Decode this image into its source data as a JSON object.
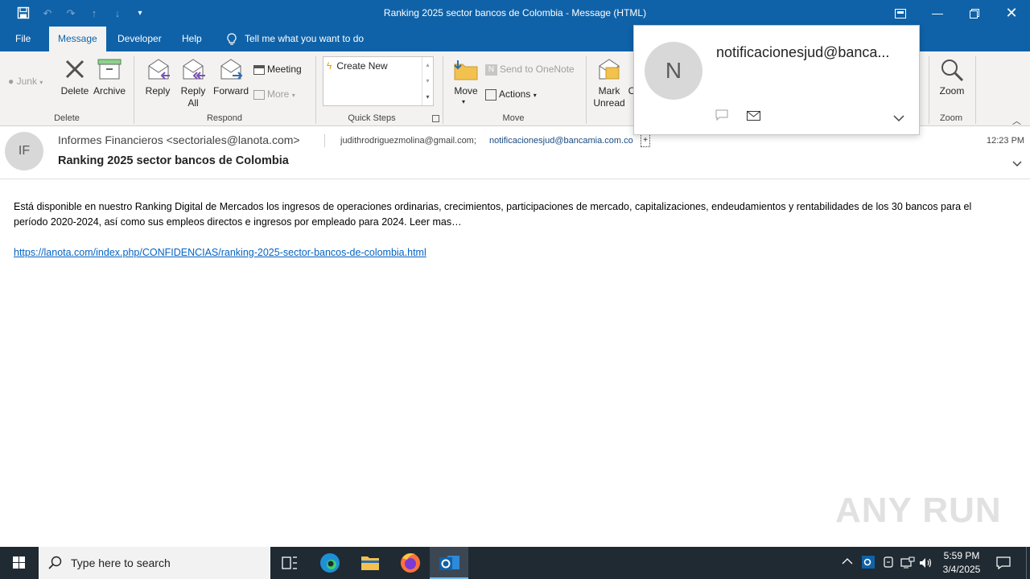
{
  "window": {
    "title": "Ranking 2025 sector bancos de Colombia  -  Message (HTML)"
  },
  "tabs": [
    {
      "label": "File"
    },
    {
      "label": "Message"
    },
    {
      "label": "Developer"
    },
    {
      "label": "Help"
    }
  ],
  "tell_me": "Tell me what you want to do",
  "ribbon": {
    "junk": "Junk",
    "delete": "Delete",
    "archive": "Archive",
    "group_delete": "Delete",
    "reply": "Reply",
    "reply_all_1": "Reply",
    "reply_all_2": "All",
    "forward": "Forward",
    "meeting": "Meeting",
    "more": "More",
    "group_respond": "Respond",
    "create_new": "Create New",
    "group_quick_steps": "Quick Steps",
    "move": "Move",
    "send_onenote": "Send to OneNote",
    "actions": "Actions",
    "group_move": "Move",
    "mark_unread_1": "Mark",
    "mark_unread_2": "Unread",
    "partial_c": "C",
    "zoom": "Zoom",
    "group_zoom": "Zoom"
  },
  "message": {
    "sender_initials": "IF",
    "from": "Informes Financieros <sectoriales@lanota.com>",
    "to_1": "judithrodriguezmolina@gmail.com;",
    "to_2": "notificacionesjud@bancamia.com.co",
    "to_more": "+",
    "time": "12:23 PM",
    "subject": "Ranking 2025 sector bancos de Colombia",
    "body_line": "Está disponible en nuestro Ranking Digital  de Mercados los ingresos de operaciones ordinarias, crecimientos, participaciones de mercado, capitalizaciones, endeudamientos y rentabilidades de los 30 bancos para el período 2020-2024,  así como sus empleos directos e ingresos por empleado para 2024.  Leer mas…",
    "link": "https://lanota.com/index.php/CONFIDENCIAS/ranking-2025-sector-bancos-de-colombia.html"
  },
  "contact_card": {
    "initial": "N",
    "name": "notificacionesjud@banca..."
  },
  "watermark": "ANY RUN",
  "taskbar": {
    "search_placeholder": "Type here to search",
    "time": "5:59 PM",
    "date": "3/4/2025"
  },
  "colors": {
    "titlebar": "#0f62a8",
    "ribbon": "#f3f2f1",
    "link": "#0563c1",
    "taskbar": "#1f2a33"
  }
}
